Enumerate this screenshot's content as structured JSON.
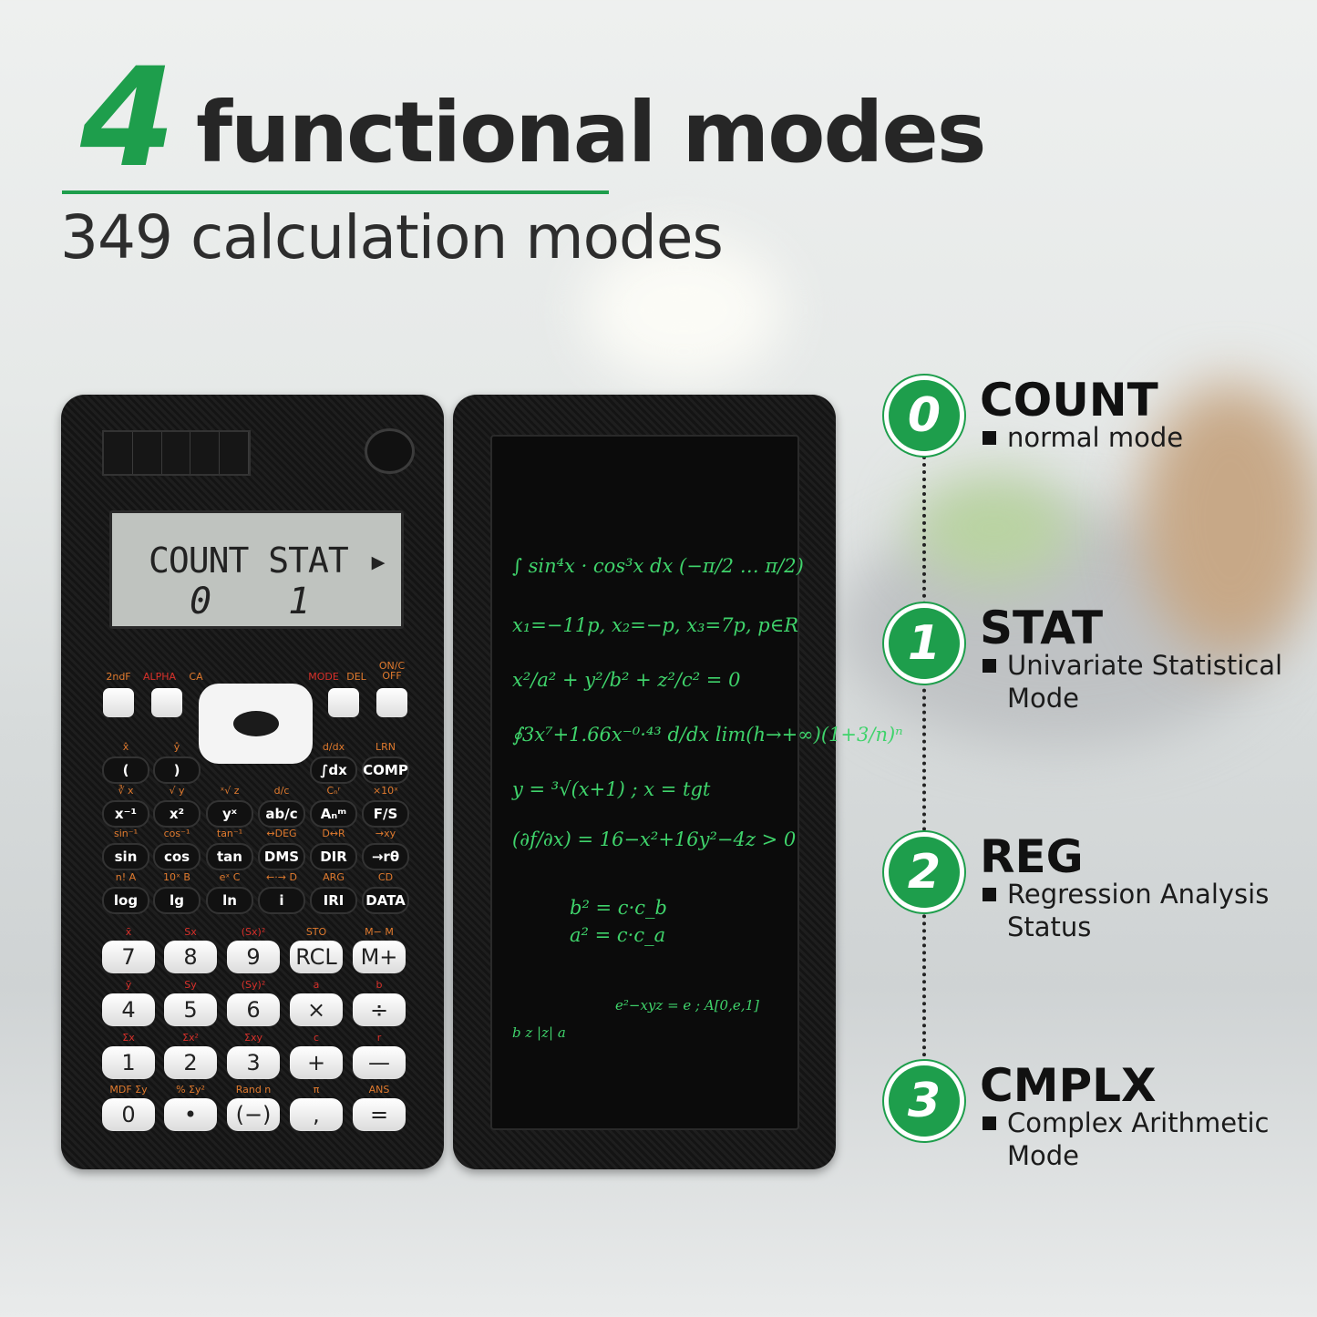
{
  "heading": {
    "number": "4",
    "title": "functional modes",
    "subtitle": "349 calculation modes"
  },
  "colors": {
    "accent": "#1e9e4c",
    "shift_label": "#e07a2e",
    "alpha_label": "#d8302a"
  },
  "lcd": {
    "line1": "COUNT STAT ▸",
    "line2": "0 1"
  },
  "top_labels": [
    {
      "t": "2ndF",
      "c": "o"
    },
    {
      "t": "ALPHA",
      "c": "r"
    },
    {
      "t": "CA",
      "c": "o"
    },
    {
      "t": "MODE",
      "c": "r"
    },
    {
      "t": "DEL",
      "c": "o"
    },
    {
      "t": "ON/C OFF",
      "c": "o"
    }
  ],
  "black_keys": [
    [
      {
        "k": "(",
        "a": "x̂"
      },
      {
        "k": ")",
        "a": "ŷ"
      },
      null,
      null,
      {
        "k": "∫dx",
        "a": "d/dx"
      },
      {
        "k": "COMP",
        "a": "LRN"
      }
    ],
    [
      {
        "k": "x⁻¹",
        "a": "∛  x"
      },
      {
        "k": "x²",
        "a": "√  y"
      },
      {
        "k": "yˣ",
        "a": "ˣ√  z"
      },
      {
        "k": "ab/c",
        "a": "d/c"
      },
      {
        "k": "Aₙᵐ",
        "a": "Cₙʳ"
      },
      {
        "k": "F/S",
        "a": "×10ˣ"
      }
    ],
    [
      {
        "k": "sin",
        "a": "sin⁻¹"
      },
      {
        "k": "cos",
        "a": "cos⁻¹"
      },
      {
        "k": "tan",
        "a": "tan⁻¹"
      },
      {
        "k": "DMS",
        "a": "↔DEG"
      },
      {
        "k": "DIR",
        "a": "D↔R"
      },
      {
        "k": "→rθ",
        "a": "→xy"
      }
    ],
    [
      {
        "k": "log",
        "a": "n!  A"
      },
      {
        "k": "lg",
        "a": "10ˣ  B"
      },
      {
        "k": "ln",
        "a": "eˣ  C"
      },
      {
        "k": "i",
        "a": "←·→ D"
      },
      {
        "k": "IRI",
        "a": "ARG"
      },
      {
        "k": "DATA",
        "a": "CD"
      }
    ]
  ],
  "white_keys": [
    [
      {
        "k": "7",
        "a": "x̄"
      },
      {
        "k": "8",
        "a": "Sx"
      },
      {
        "k": "9",
        "a": "(Sx)²"
      },
      {
        "k": "RCL",
        "a": "STO"
      },
      {
        "k": "M+",
        "a": "M−  M"
      }
    ],
    [
      {
        "k": "4",
        "a": "ȳ"
      },
      {
        "k": "5",
        "a": "Sy"
      },
      {
        "k": "6",
        "a": "(Sy)²"
      },
      {
        "k": "×",
        "a": "a"
      },
      {
        "k": "÷",
        "a": "b"
      }
    ],
    [
      {
        "k": "1",
        "a": "Σx"
      },
      {
        "k": "2",
        "a": "Σx²"
      },
      {
        "k": "3",
        "a": "Σxy"
      },
      {
        "k": "+",
        "a": "c"
      },
      {
        "k": "—",
        "a": "r"
      }
    ],
    [
      {
        "k": "0",
        "a": "MDF  Σy"
      },
      {
        "k": "•",
        "a": "%  Σy²"
      },
      {
        "k": "(−)",
        "a": "Rand  n"
      },
      {
        "k": ",",
        "a": "π"
      },
      {
        "k": "=",
        "a": "ANS"
      }
    ]
  ],
  "writing_pad": [
    "∫ sin⁴x · cos³x dx  (−π/2 … π/2)",
    "x₁=−11p, x₂=−p, x₃=7p, p∈R",
    "x²/a² + y²/b² + z²/c² = 0",
    "∮3x⁷+1.66x⁻⁰·⁴³ d/dx  lim(h→+∞)(1+3/n)ⁿ",
    "y = ³√(x+1) ; x = tgt",
    "(∂f/∂x) = 16−x²+16y²−4z > 0",
    "b² = c·c_b",
    "a² = c·c_a",
    "e²−xyz = e ; A[0,e,1]",
    "b    z    |z|    a"
  ],
  "modes": [
    {
      "num": "0",
      "name": "COUNT",
      "desc": "normal mode"
    },
    {
      "num": "1",
      "name": "STAT",
      "desc": "Univariate Statistical Mode"
    },
    {
      "num": "2",
      "name": "REG",
      "desc": "Regression Analysis Status"
    },
    {
      "num": "3",
      "name": "CMPLX",
      "desc": "Complex Arithmetic Mode"
    }
  ]
}
